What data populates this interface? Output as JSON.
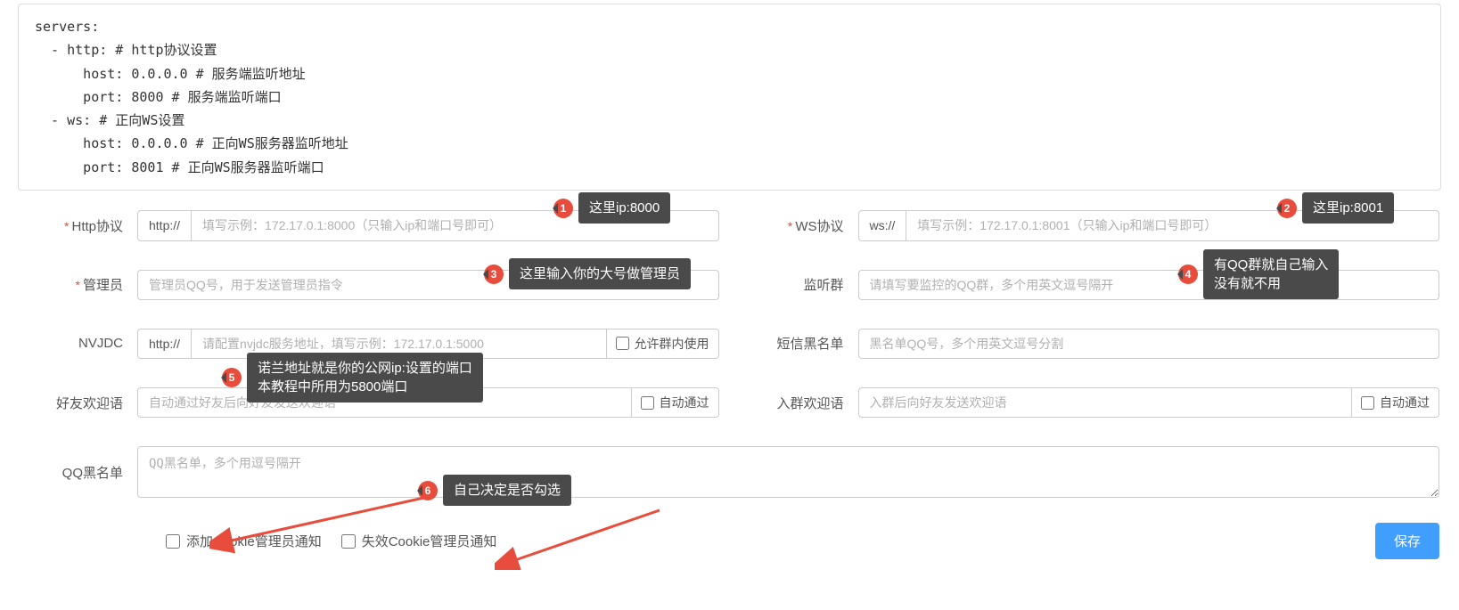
{
  "code": {
    "block": "servers:\n  - http: # http协议设置\n      host: 0.0.0.0 # 服务端监听地址\n      port: 8000 # 服务端监听端口\n  - ws: # 正向WS设置\n      host: 0.0.0.0 # 正向WS服务器监听地址\n      port: 8001 # 正向WS服务器监听端口"
  },
  "form": {
    "http": {
      "label": "Http协议",
      "addon": "http://",
      "placeholder": "填写示例：172.17.0.1:8000（只输入ip和端口号即可）"
    },
    "ws": {
      "label": "WS协议",
      "addon": "ws://",
      "placeholder": "填写示例：172.17.0.1:8001（只输入ip和端口号即可）"
    },
    "admin": {
      "label": "管理员",
      "placeholder": "管理员QQ号，用于发送管理员指令"
    },
    "listen": {
      "label": "监听群",
      "placeholder": "请填写要监控的QQ群，多个用英文逗号隔开"
    },
    "nvjdc": {
      "label": "NVJDC",
      "addon": "http://",
      "placeholder": "请配置nvjdc服务地址，填写示例：172.17.0.1:5000",
      "suffix": "允许群内使用"
    },
    "sms": {
      "label": "短信黑名单",
      "placeholder": "黑名单QQ号，多个用英文逗号分割"
    },
    "friend": {
      "label": "好友欢迎语",
      "placeholder": "自动通过好友后向好友发送欢迎语",
      "suffix": "自动通过"
    },
    "group": {
      "label": "入群欢迎语",
      "placeholder": "入群后向好友发送欢迎语",
      "suffix": "自动通过"
    },
    "qqbl": {
      "label": "QQ黑名单",
      "placeholder": "QQ黑名单，多个用逗号隔开"
    }
  },
  "footer": {
    "add_cookie": "添加Cookie管理员通知",
    "invalid_cookie": "失效Cookie管理员通知",
    "save": "保存"
  },
  "annotations": {
    "a1": {
      "num": "1",
      "text": "这里ip:8000"
    },
    "a2": {
      "num": "2",
      "text": "这里ip:8001"
    },
    "a3": {
      "num": "3",
      "text": "这里输入你的大号做管理员"
    },
    "a4": {
      "num": "4",
      "text": "有QQ群就自己输入\n没有就不用"
    },
    "a5": {
      "num": "5",
      "text": "诺兰地址就是你的公网ip:设置的端口\n本教程中所用为5800端口"
    },
    "a6": {
      "num": "6",
      "text": "自己决定是否勾选"
    }
  }
}
